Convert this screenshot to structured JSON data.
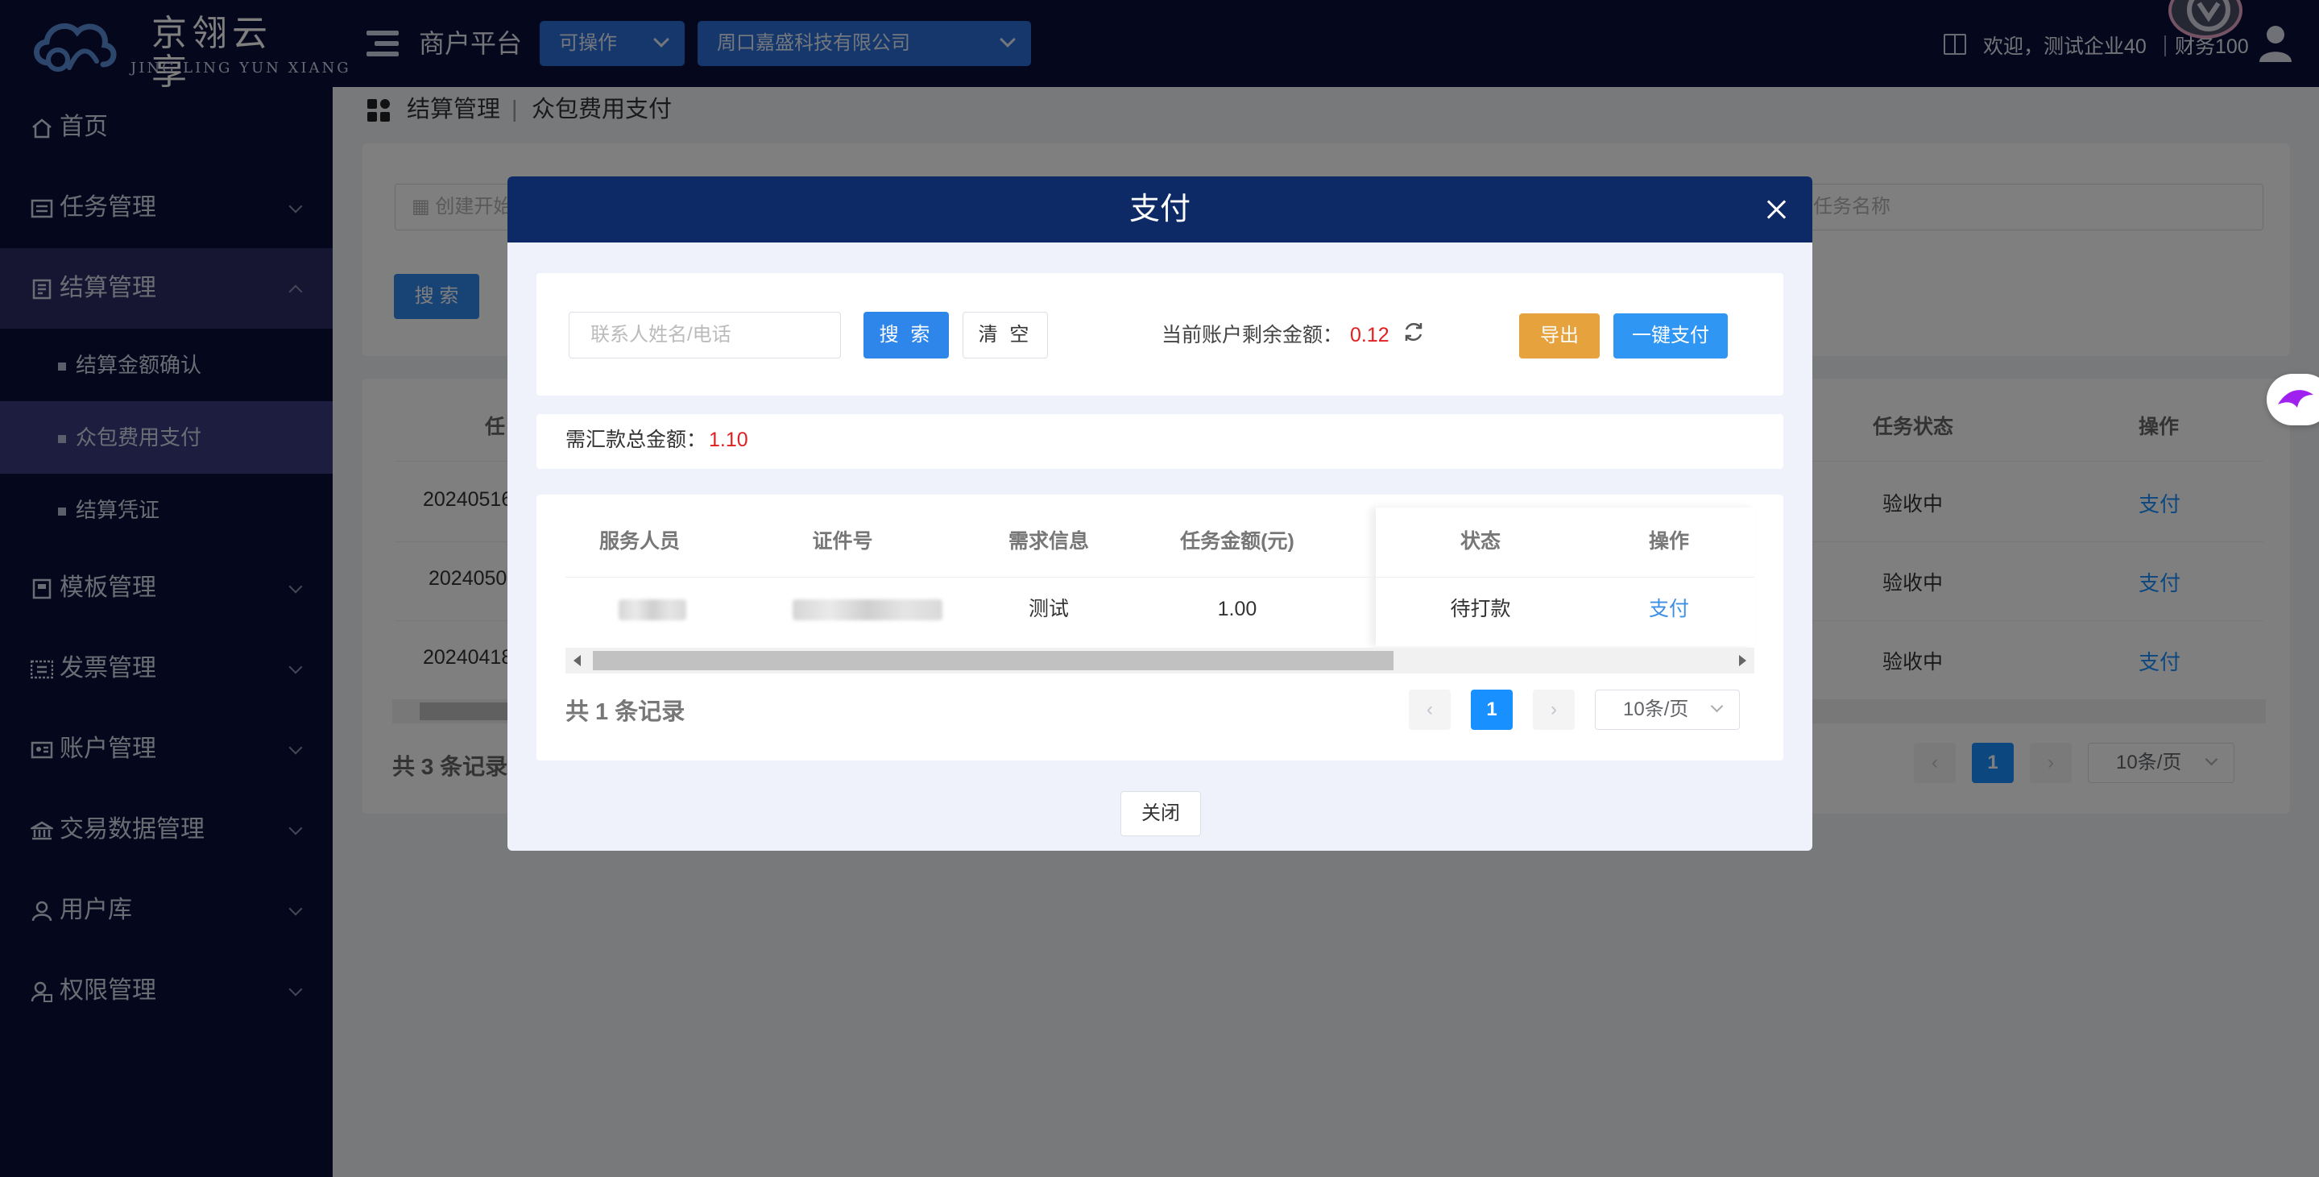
{
  "brand": {
    "name_cn": "京翎云享",
    "name_en": "JING LING YUN XIANG"
  },
  "header": {
    "platform_title": "商户平台",
    "status_select": "可操作",
    "company_select": "周口嘉盛科技有限公司",
    "welcome": "欢迎，测试企业40",
    "role": "财务100"
  },
  "sidebar": {
    "items": [
      {
        "label": "首页",
        "icon": "home-icon"
      },
      {
        "label": "任务管理",
        "icon": "task-icon"
      },
      {
        "label": "结算管理",
        "icon": "settlement-icon"
      },
      {
        "label": "模板管理",
        "icon": "template-icon"
      },
      {
        "label": "发票管理",
        "icon": "invoice-icon"
      },
      {
        "label": "账户管理",
        "icon": "account-icon"
      },
      {
        "label": "交易数据管理",
        "icon": "bank-icon"
      },
      {
        "label": "用户库",
        "icon": "user-icon"
      },
      {
        "label": "权限管理",
        "icon": "permission-icon"
      }
    ],
    "sub_items": [
      {
        "label": "结算金额确认"
      },
      {
        "label": "众包费用支付"
      },
      {
        "label": "结算凭证"
      }
    ]
  },
  "breadcrumb": {
    "level1": "结算管理",
    "separator": "|",
    "level2": "众包费用支付"
  },
  "page": {
    "filter": {
      "created_start_placeholder": "创建开始",
      "task_name_placeholder": "任务名称",
      "search_label": "搜 索"
    },
    "table": {
      "headers": {
        "col1": "任",
        "status": "任务状态",
        "action": "操作"
      },
      "rows": [
        {
          "id": "20240516",
          "status": "验收中",
          "action": "支付"
        },
        {
          "id": "2024050",
          "status": "验收中",
          "action": "支付"
        },
        {
          "id": "20240418",
          "status": "验收中",
          "action": "支付"
        }
      ]
    },
    "total": "共 3 条记录",
    "pagination": {
      "current": "1",
      "page_size": "10条/页"
    }
  },
  "modal": {
    "title": "支付",
    "search_placeholder": "联系人姓名/电话",
    "search_label": "搜 索",
    "clear_label": "清 空",
    "balance_label": "当前账户剩余金额：",
    "balance_value": "0.12",
    "export_label": "导出",
    "pay_all_label": "一键支付",
    "sum_label": "需汇款总金额：",
    "sum_value": "1.10",
    "table": {
      "headers": [
        "服务人员",
        "证件号",
        "需求信息",
        "任务金额(元)",
        "状态",
        "操作"
      ],
      "rows": [
        {
          "worker": "",
          "id_number": "",
          "demand": "测试",
          "amount": "1.00",
          "status": "待打款",
          "action": "支付"
        }
      ]
    },
    "total": "共 1 条记录",
    "pagination": {
      "current": "1",
      "page_size": "10条/页"
    },
    "close_label": "关闭"
  },
  "colors": {
    "header_bg": "#0b0f3a",
    "modal_head": "#0d2a66",
    "primary": "#2f86ea",
    "warning": "#e6a23c",
    "danger": "#e02020",
    "link": "#1890ff"
  }
}
